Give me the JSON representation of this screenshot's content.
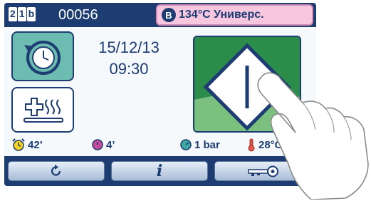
{
  "header": {
    "program_code": [
      "2",
      "1",
      "b"
    ],
    "program_number": "00056",
    "mode_letter": "B",
    "mode_text": "134°C Универс."
  },
  "datetime": {
    "date": "15/12/13",
    "time": "09:30"
  },
  "status": {
    "timer": "42’",
    "cycle_time": "4’",
    "pressure": "1 bar",
    "temperature": "28°C"
  },
  "icons": {
    "timer_button": "clock-refresh-icon",
    "steam_button": "plus-steam-icon",
    "start_button": "start-diamond-icon",
    "nav_1": "refresh-icon",
    "nav_2": "info-icon",
    "nav_3": "key-icon",
    "nav_2_glyph": "i"
  },
  "colors": {
    "header_bg": "#1d3d72",
    "badge_bg": "#f7c6df",
    "timer_button_bg": "#6cbcb1",
    "start_button_bg": "#2c8c4a",
    "status_text": "#1d3d72"
  }
}
